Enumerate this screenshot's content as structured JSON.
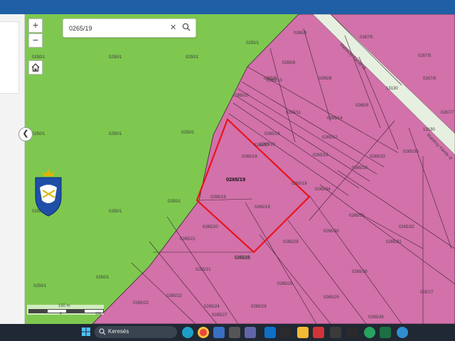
{
  "search": {
    "value": "0265/19",
    "clear_icon": "close-icon",
    "search_icon": "search-icon"
  },
  "controls": {
    "zoom_in": "+",
    "zoom_out": "−",
    "home_icon": "home-icon",
    "collapse_icon": "chevron-left-icon"
  },
  "map": {
    "selected_parcel": "0265/19",
    "colors": {
      "green": "#7ec850",
      "pink": "#d271aa",
      "road": "#e7efe0",
      "selected_outline": "#e8141c",
      "lines": "#3d2430"
    },
    "streets": [
      "Matolcsy Károly út",
      "Matolcsy Károly út"
    ],
    "street_number": "13130",
    "parcel_labels": [
      "0250/1",
      "0250/1",
      "0250/1",
      "0250/1",
      "0250/1",
      "0250/1",
      "0250/1",
      "0250/1",
      "0250/1",
      "0250/1",
      "0250/1",
      "0250/1",
      "0265/8",
      "0265/8",
      "0265/8",
      "0265/9",
      "0265/10",
      "0265/11",
      "0265/16",
      "0265/17",
      "0265/18",
      "0265/19",
      "0265/19",
      "0265/19",
      "0265/19",
      "0265/20",
      "0265/21",
      "0265/21",
      "0265/22",
      "0265/23",
      "0265/24",
      "0265/25",
      "0265/26",
      "0265/27",
      "0265/28",
      "0265/29",
      "0265/29",
      "0265/29",
      "0265/30",
      "0265/31",
      "0265/31",
      "0265/32",
      "0265/33",
      "0265/34",
      "0265/35",
      "0265/36",
      "0265/38",
      "0265/39",
      "0267/5",
      "0267/5",
      "0267/6",
      "0267/7",
      "0267/7",
      "0265/10",
      "0265/14",
      "0265/12",
      "0265/16",
      "0265/9",
      "0265/20"
    ]
  },
  "scale": {
    "label": "150 m",
    "tick0": "0",
    "tick1": "150"
  },
  "taskbar": {
    "search_label": "Keresés"
  },
  "emblem": {
    "name": "town-coat-of-arms"
  }
}
